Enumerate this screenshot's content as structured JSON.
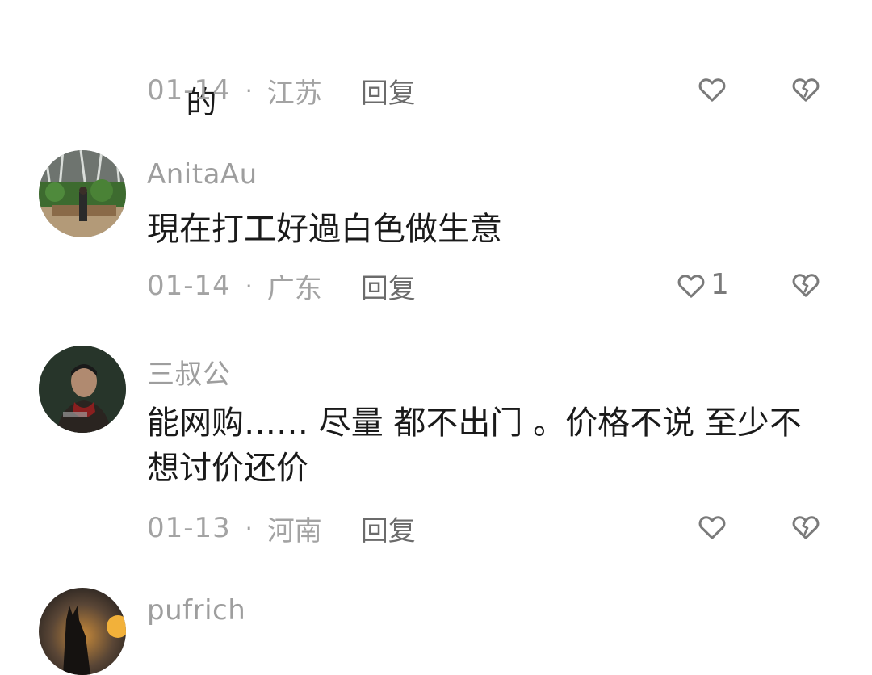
{
  "top_comment": {
    "text_tail": "的",
    "date": "01-14",
    "region": "江苏",
    "reply_label": "回复"
  },
  "comments": [
    {
      "username": "AnitaAu",
      "text": "現在打工好過白色做生意",
      "date": "01-14",
      "region": "广东",
      "reply_label": "回复",
      "like_count": "1"
    },
    {
      "username": "三叔公",
      "text": "能网购…… 尽量 都不出门 。价格不说 至少不想讨价还价",
      "date": "01-13",
      "region": "河南",
      "reply_label": "回复",
      "like_count": ""
    },
    {
      "username": "pufrich"
    }
  ],
  "icons": {
    "like": "heart-outline-icon",
    "dislike": "broken-heart-icon"
  },
  "colors": {
    "text": "#1a1a1a",
    "meta": "#a3a3a3",
    "reply": "#6b6b6b",
    "icon": "#7a7a7a"
  }
}
